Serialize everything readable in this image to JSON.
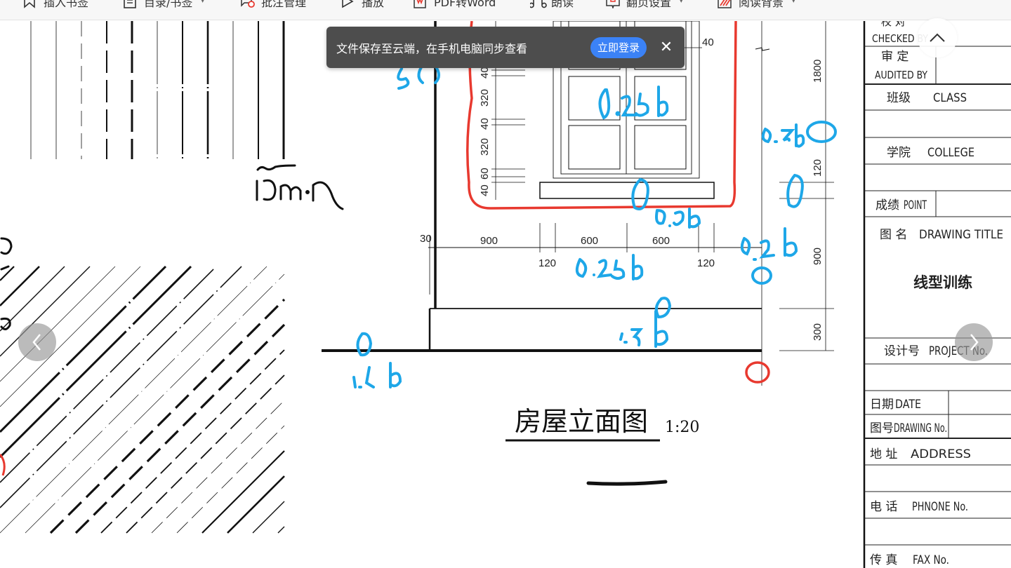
{
  "toolbar": {
    "items": [
      {
        "label": "插入书签",
        "icon": "bookmark-icon",
        "has_caret": false
      },
      {
        "label": "目录/书签",
        "icon": "toc-icon",
        "has_caret": true
      },
      {
        "label": "批注管理",
        "icon": "annotation-icon",
        "has_caret": false
      },
      {
        "label": "播放",
        "icon": "play-icon",
        "has_caret": false
      },
      {
        "label": "PDF转Word",
        "icon": "pdf-word-icon",
        "has_caret": false
      },
      {
        "label": "朗读",
        "icon": "read-aloud-icon",
        "has_caret": false
      },
      {
        "label": "翻页设置",
        "icon": "page-turn-icon",
        "has_caret": true
      },
      {
        "label": "阅读背景",
        "icon": "reading-background-icon",
        "has_caret": true
      }
    ],
    "caret_glyph": "▾"
  },
  "toast": {
    "message": "文件保存至云端，在手机电脑同步查看",
    "login_button": "立即登录",
    "close_glyph": "✕"
  },
  "navigation": {
    "prev_glyph": "‹",
    "next_glyph": "›",
    "up_glyph": "︿"
  },
  "drawing": {
    "title": "房屋立面图",
    "scale": "1:20",
    "window_dims_vertical": [
      "40",
      "320",
      "40",
      "320",
      "60",
      "40"
    ],
    "window_dim_top_right": "40",
    "horizontal_dims_top": [
      "30",
      "900",
      "600",
      "600"
    ],
    "horizontal_dims_bottom": [
      "120",
      "120"
    ],
    "right_dims": [
      "1800",
      "120",
      "900",
      "300"
    ]
  },
  "annotations": {
    "handwritten_blue": [
      "0.25b",
      "0.25b0",
      "0",
      "0.5b",
      "0.25b",
      "0.25b",
      "0",
      "0.25b",
      "b",
      "1.5b",
      "5b"
    ],
    "handwritten_black": [
      "15mm"
    ],
    "colors": {
      "blue": "#1ea7e8",
      "red": "#e8392f",
      "black": "#111111"
    }
  },
  "title_block": {
    "rows": [
      {
        "cn": "校 对",
        "en": "CHECKED BY"
      },
      {
        "cn": "审 定",
        "en": "AUDITED BY"
      },
      {
        "cn": "班级",
        "en": "CLASS"
      },
      {
        "cn": "学院",
        "en": "COLLEGE"
      },
      {
        "cn": "成绩",
        "en": "POINT"
      },
      {
        "cn": "图 名",
        "en": "DRAWING TITLE"
      },
      {
        "cn": "设计号",
        "en": "PROJECT No."
      },
      {
        "cn": "日期",
        "en": "DATE"
      },
      {
        "cn": "图号",
        "en": "DRAWING No."
      },
      {
        "cn": "地 址",
        "en": "ADDRESS"
      },
      {
        "cn": "电 话",
        "en": "PHNONE No."
      },
      {
        "cn": "传 真",
        "en": "FAX No."
      }
    ],
    "drawing_title_value": "线型训练"
  }
}
